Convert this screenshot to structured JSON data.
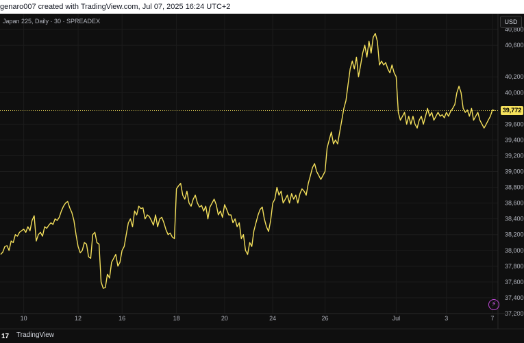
{
  "header": {
    "caption": "genaro007 created with TradingView.com, Jul 07, 2025 16:24 UTC+2"
  },
  "symbol_label": "Japan 225, Daily · 30 · SPREADEX",
  "currency_button": "USD",
  "footer": {
    "logo": "17",
    "brand": "TradingView"
  },
  "last_price_label": "39,772",
  "spark_icon": "lightning-icon",
  "colors": {
    "line": "#f5e15c",
    "background": "#0f0f0f",
    "grid": "#1c1c1c",
    "price_line": "#f5e15c"
  },
  "chart_data": {
    "type": "line",
    "xlabel": "",
    "ylabel": "",
    "ylim": [
      37200,
      41000
    ],
    "last_value": 39772,
    "grid": true,
    "y_ticks": [
      37200,
      37400,
      37600,
      37800,
      38000,
      38200,
      38400,
      38600,
      38800,
      39000,
      39200,
      39400,
      39600,
      40000,
      40200,
      40600,
      40800
    ],
    "y_tick_labels": [
      "37,200",
      "37,400",
      "37,600",
      "37,800",
      "38,000",
      "38,200",
      "38,400",
      "38,600",
      "38,800",
      "39,000",
      "39,200",
      "39,400",
      "39,600",
      "40,000",
      "40,200",
      "40,600",
      "40,800"
    ],
    "x_ticks": [
      {
        "label": "10",
        "i": 11
      },
      {
        "label": "12",
        "i": 37
      },
      {
        "label": "16",
        "i": 58
      },
      {
        "label": "18",
        "i": 84
      },
      {
        "label": "20",
        "i": 107
      },
      {
        "label": "24",
        "i": 130
      },
      {
        "label": "26",
        "i": 155
      },
      {
        "label": "Jul",
        "i": 189
      },
      {
        "label": "3",
        "i": 213
      },
      {
        "label": "7",
        "i": 235
      }
    ],
    "series": [
      {
        "values": [
          37950,
          37980,
          38050,
          38060,
          38000,
          38120,
          38100,
          38200,
          38180,
          38230,
          38250,
          38270,
          38230,
          38300,
          38250,
          38380,
          38440,
          38120,
          38200,
          38230,
          38180,
          38300,
          38280,
          38320,
          38350,
          38330,
          38400,
          38380,
          38420,
          38500,
          38560,
          38600,
          38620,
          38540,
          38480,
          38380,
          38200,
          38050,
          37970,
          38000,
          38100,
          38080,
          37920,
          37900,
          38200,
          38230,
          38100,
          38080,
          37600,
          37520,
          37530,
          37700,
          37650,
          37850,
          37900,
          37950,
          37800,
          37850,
          38000,
          38050,
          38200,
          38350,
          38400,
          38300,
          38500,
          38450,
          38560,
          38530,
          38540,
          38400,
          38450,
          38430,
          38380,
          38320,
          38450,
          38300,
          38400,
          38420,
          38350,
          38260,
          38200,
          38220,
          38170,
          38150,
          38780,
          38820,
          38850,
          38700,
          38650,
          38750,
          38600,
          38560,
          38650,
          38700,
          38600,
          38550,
          38570,
          38500,
          38560,
          38400,
          38550,
          38600,
          38650,
          38580,
          38450,
          38500,
          38420,
          38580,
          38520,
          38450,
          38450,
          38350,
          38400,
          38300,
          38350,
          38150,
          38200,
          38000,
          37950,
          38100,
          38050,
          38250,
          38350,
          38450,
          38520,
          38550,
          38400,
          38300,
          38240,
          38380,
          38600,
          38650,
          38800,
          38700,
          38750,
          38600,
          38650,
          38700,
          38600,
          38720,
          38650,
          38700,
          38600,
          38720,
          38780,
          38750,
          38700,
          38850,
          38950,
          39050,
          39100,
          39000,
          38950,
          38900,
          38950,
          39000,
          39300,
          39400,
          39500,
          39350,
          39400,
          39350,
          39500,
          39650,
          39800,
          39900,
          40100,
          40300,
          40400,
          40300,
          40450,
          40200,
          40350,
          40500,
          40600,
          40450,
          40650,
          40500,
          40700,
          40750,
          40650,
          40350,
          40400,
          40350,
          40380,
          40300,
          40250,
          40350,
          40250,
          40200,
          39750,
          39650,
          39700,
          39750,
          39600,
          39700,
          39600,
          39700,
          39600,
          39550,
          39650,
          39700,
          39600,
          39700,
          39800,
          39700,
          39750,
          39650,
          39700,
          39750,
          39700,
          39720,
          39680,
          39750,
          39700,
          39760,
          39800,
          39850,
          40000,
          40080,
          40000,
          39800,
          39750,
          39780,
          39700,
          39800,
          39650,
          39700,
          39750,
          39650,
          39600,
          39550,
          39600,
          39650,
          39700,
          39780,
          39772
        ]
      }
    ]
  }
}
